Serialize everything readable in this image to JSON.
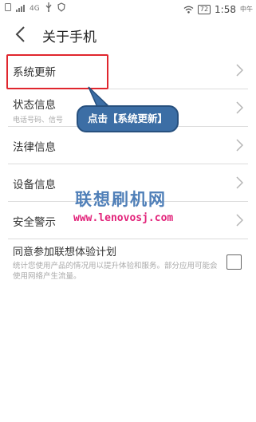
{
  "status_bar": {
    "signal_text": "4G",
    "time": "1:58",
    "ampm": "中午",
    "battery": "72"
  },
  "header": {
    "title": "关于手机"
  },
  "menu": {
    "items": [
      {
        "label": "系统更新",
        "sub": ""
      },
      {
        "label": "状态信息",
        "sub": "电话号码、信号"
      },
      {
        "label": "法律信息",
        "sub": ""
      },
      {
        "label": "设备信息",
        "sub": ""
      },
      {
        "label": "安全警示",
        "sub": ""
      }
    ]
  },
  "consent": {
    "label": "同意参加联想体验计划",
    "description": "统计您使用产品的情况用以提升体验和服务。部分应用可能会使用网络产生流量。",
    "checked": false
  },
  "annotation": {
    "callout_text": "点击【系统更新】",
    "highlight_color": "#e0262e",
    "callout_color": "#3c6ea5"
  },
  "watermark": {
    "brand": "联想刷机网",
    "url": "www.lenovosj.com"
  }
}
